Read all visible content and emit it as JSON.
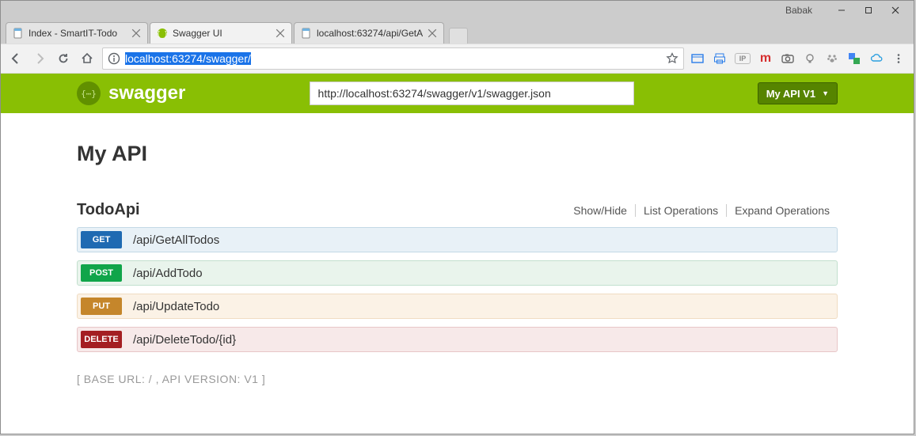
{
  "window": {
    "user": "Babak"
  },
  "tabs": [
    {
      "label": "Index - SmartIT-Todo",
      "active": false
    },
    {
      "label": "Swagger UI",
      "active": true
    },
    {
      "label": "localhost:63274/api/GetA",
      "active": false
    }
  ],
  "address": {
    "prefix": "",
    "selected": "localhost:63274/swagger/"
  },
  "header": {
    "logo_text": "swagger",
    "json_url": "http://localhost:63274/swagger/v1/swagger.json",
    "dropdown_label": "My API V1"
  },
  "page": {
    "title": "My API",
    "section_name": "TodoApi",
    "actions": {
      "showhide": "Show/Hide",
      "list": "List Operations",
      "expand": "Expand Operations"
    },
    "operations": [
      {
        "verb": "GET",
        "path": "/api/GetAllTodos",
        "cls": "op-get"
      },
      {
        "verb": "POST",
        "path": "/api/AddTodo",
        "cls": "op-post"
      },
      {
        "verb": "PUT",
        "path": "/api/UpdateTodo",
        "cls": "op-put"
      },
      {
        "verb": "DELETE",
        "path": "/api/DeleteTodo/{id}",
        "cls": "op-delete"
      }
    ],
    "footer": "[ BASE URL: / , API VERSION: V1 ]"
  }
}
